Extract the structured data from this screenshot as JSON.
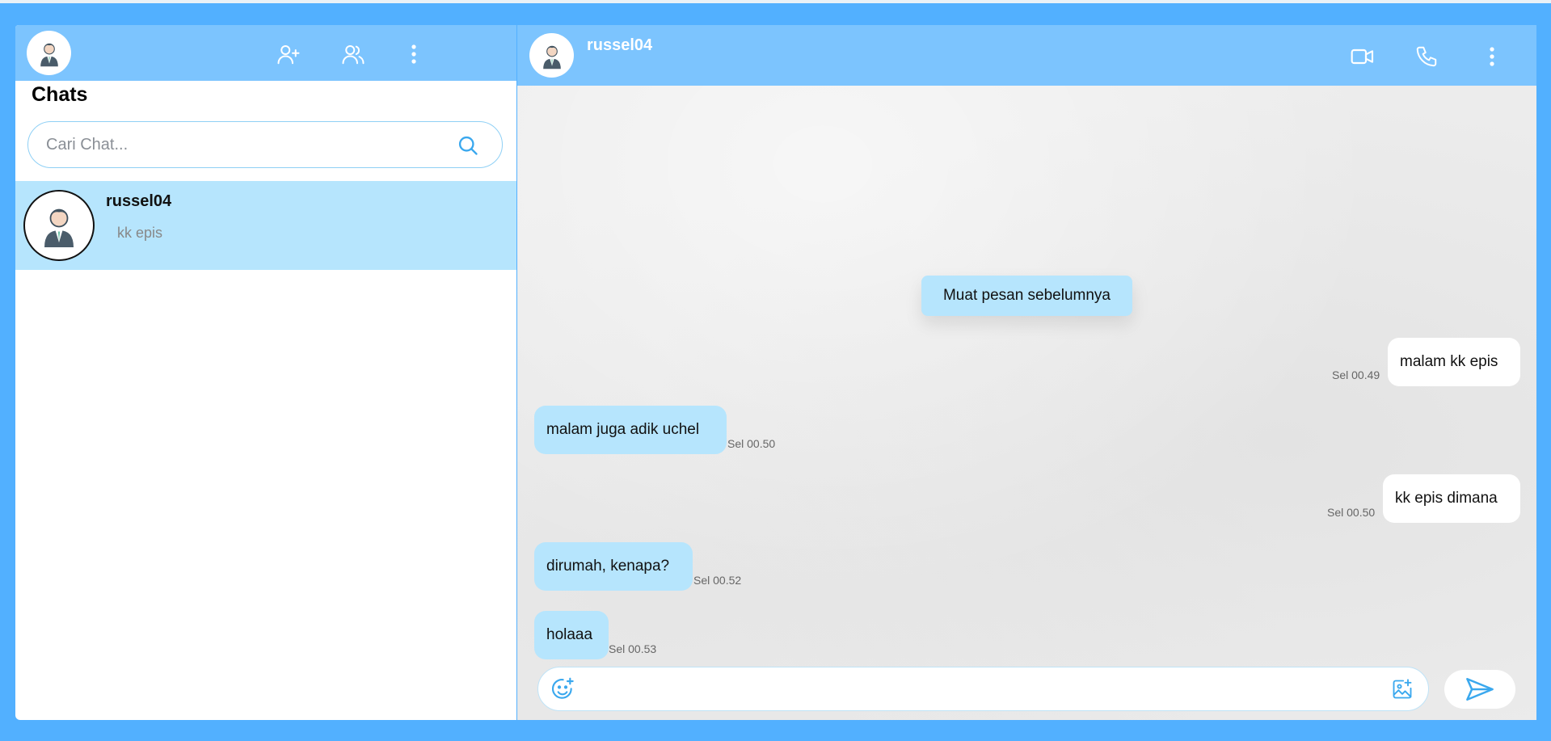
{
  "sidebar": {
    "title": "Chats",
    "search_placeholder": "Cari Chat...",
    "search_value": "",
    "chats": [
      {
        "name": "russel04",
        "preview": "kk epis"
      }
    ]
  },
  "conversation": {
    "contact_name": "russel04",
    "load_more_label": "Muat pesan sebelumnya",
    "messages": [
      {
        "direction": "out",
        "text": "malam kk epis",
        "time": "Sel 00.49"
      },
      {
        "direction": "in",
        "text": "malam juga adik uchel",
        "time": "Sel 00.50"
      },
      {
        "direction": "out",
        "text": "kk epis dimana",
        "time": "Sel 00.50"
      },
      {
        "direction": "in",
        "text": "dirumah, kenapa?",
        "time": "Sel 00.52"
      },
      {
        "direction": "in",
        "text": "holaaa",
        "time": "Sel 00.53"
      }
    ],
    "composer_value": ""
  },
  "colors": {
    "background": "#52b0ff",
    "header": "#7cc4fe",
    "incoming_bubble": "#b6e5fd",
    "outgoing_bubble": "#ffffff",
    "accent": "#3aa8ee"
  },
  "icons": {
    "left_header": [
      "user-avatar-icon",
      "add-user-icon",
      "group-icon",
      "more-vertical-icon"
    ],
    "right_header": [
      "contact-avatar-icon",
      "video-call-icon",
      "phone-icon",
      "more-vertical-icon"
    ],
    "composer": [
      "emoji-icon",
      "add-image-icon",
      "send-icon"
    ]
  }
}
